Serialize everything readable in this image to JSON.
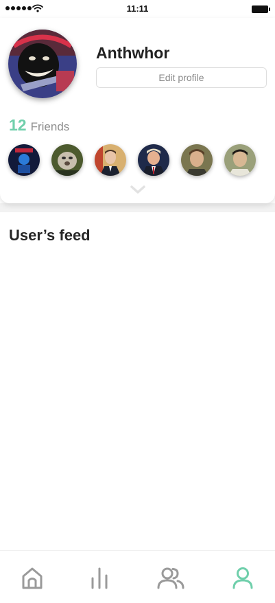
{
  "status_bar": {
    "time": "11:11",
    "signal_icon": "signal-dots-icon",
    "wifi_icon": "wifi-icon",
    "battery_icon": "battery-icon"
  },
  "profile": {
    "name": "Anthwhor",
    "edit_button_label": "Edit profile",
    "avatar_icon": "user-avatar"
  },
  "friends": {
    "count": "12",
    "label": "Friends",
    "visible_avatars": [
      {
        "icon": "friend-avatar-1"
      },
      {
        "icon": "friend-avatar-2"
      },
      {
        "icon": "friend-avatar-3"
      },
      {
        "icon": "friend-avatar-4"
      },
      {
        "icon": "friend-avatar-5"
      },
      {
        "icon": "friend-avatar-6"
      }
    ],
    "expand_icon": "chevron-down-icon"
  },
  "feed": {
    "title": "User’s feed"
  },
  "bottom_nav": {
    "items": [
      {
        "icon": "home-icon",
        "active": false
      },
      {
        "icon": "bar-chart-icon",
        "active": false
      },
      {
        "icon": "users-icon",
        "active": false
      },
      {
        "icon": "user-icon",
        "active": true
      }
    ]
  },
  "colors": {
    "accent": "#6fcfab",
    "nav_inactive": "#9a9a9a",
    "text_dark": "#222222",
    "text_muted": "#8d8d8d"
  }
}
